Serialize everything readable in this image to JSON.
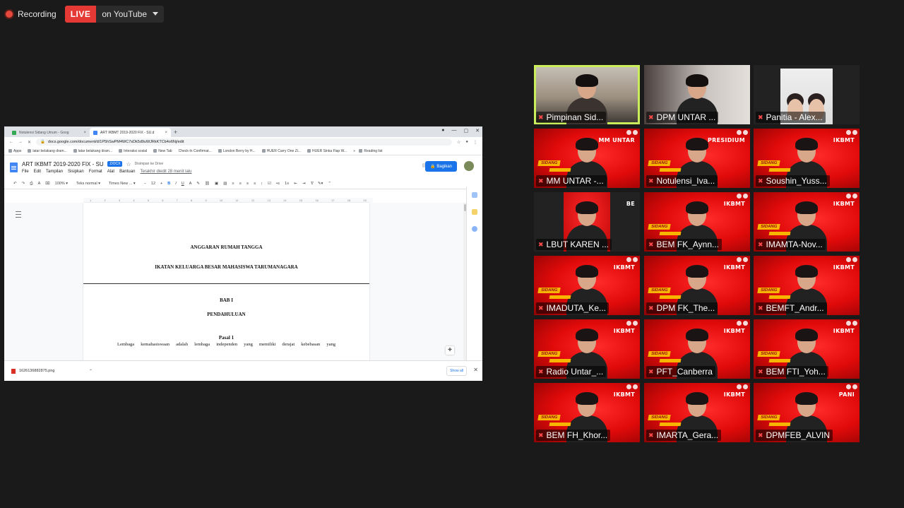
{
  "recording": {
    "label": "Recording"
  },
  "live": {
    "badge": "LIVE",
    "destination": "on YouTube"
  },
  "browser": {
    "tabs": [
      {
        "title": "Notulensi Sidang Umum - Goog",
        "icon": "docs-icon"
      },
      {
        "title": "ART IKBMT 2019-2020 FIX - SU.d",
        "icon": "docs-icon"
      }
    ],
    "url": "docs.google.com/document/d/1P5hSwPM4WC7sDk5d9uWJRkKTCb4o6Nj/edit",
    "bookmarks": [
      "Apps",
      "latar belakang dram...",
      "latar belakang dram...",
      "Interaksi sosial",
      "New Tab",
      "Check-In Confirmat...",
      "London Berry by H...",
      "HUER Carry One Zi...",
      "HUER Sinka Flap W...",
      "Reading list"
    ]
  },
  "doc": {
    "title": "ART IKBMT 2019-2020 FIX - SU",
    "format_badge": ".DOCX",
    "saved_status": "Disimpan ke Drive",
    "menu": [
      "File",
      "Edit",
      "Tampilan",
      "Sisipkan",
      "Format",
      "Alat",
      "Bantuan"
    ],
    "last_edit": "Terakhir diedit 28 menit lalu",
    "share_label": "Bagikan",
    "toolbar": {
      "zoom": "100%",
      "style": "Teks normal",
      "font": "Times New ...",
      "size": "12"
    },
    "ruler_ticks": [
      "1",
      "2",
      "3",
      "4",
      "5",
      "6",
      "7",
      "8",
      "9",
      "10",
      "11",
      "12",
      "13",
      "14",
      "15",
      "16",
      "17",
      "18",
      "19"
    ],
    "content": {
      "heading1": "ANGGARAN RUMAH TANGGA",
      "heading2": "IKATAN KELUARGA BESAR MAHASISWA TARUMANAGARA",
      "bab": "BAB I",
      "bab_title": "PENDAHULUAN",
      "pasal": "Pasal 1",
      "paragraph": "Lembaga kemahasiswaan adalah lembaga independen yang memiliki derajat kebebasan yang"
    },
    "download": {
      "file": "1626136882875.png",
      "show_all": "Show all"
    }
  },
  "participants": [
    {
      "name": "Pimpinan Sid...",
      "style": "room",
      "brand": "",
      "active": true
    },
    {
      "name": "DPM UNTAR ...",
      "style": "room2",
      "brand": ""
    },
    {
      "name": "Panitia - Alex...",
      "style": "photo",
      "brand": ""
    },
    {
      "name": "MM UNTAR -...",
      "style": "red",
      "brand": "MM UNTAR"
    },
    {
      "name": "Notulensi_Iva...",
      "style": "red",
      "brand": "PRESIDIUM"
    },
    {
      "name": "Soushin_Yuss...",
      "style": "red",
      "brand": "IKBMT"
    },
    {
      "name": "LBUT KAREN ...",
      "style": "lbut",
      "brand": "BE"
    },
    {
      "name": "BEM FK_Aynn...",
      "style": "red",
      "brand": "IKBMT"
    },
    {
      "name": "IMAMTA-Nov...",
      "style": "red",
      "brand": "IKBMT"
    },
    {
      "name": "IMADUTA_Ke...",
      "style": "red",
      "brand": "IKBMT"
    },
    {
      "name": "DPM FK_The...",
      "style": "red",
      "brand": "IKBMT"
    },
    {
      "name": "BEMFT_Andr...",
      "style": "red",
      "brand": "IKBMT"
    },
    {
      "name": "Radio Untar_...",
      "style": "red",
      "brand": "IKBMT"
    },
    {
      "name": "PFT_Canberra",
      "style": "red",
      "brand": "IKBMT"
    },
    {
      "name": "BEM FTI_Yoh...",
      "style": "red",
      "brand": "IKBMT"
    },
    {
      "name": "BEM FH_Khor...",
      "style": "red",
      "brand": "IKBMT"
    },
    {
      "name": "IMARTA_Gera...",
      "style": "red",
      "brand": "IKBMT"
    },
    {
      "name": "DPMFEB_ALVIN",
      "style": "red",
      "brand": "PANI"
    }
  ],
  "sidang_label": "SIDANG",
  "colors": {
    "live_red": "#e53935",
    "active_speaker": "#c9ed5b",
    "background": "#1a1a1a",
    "tile_red": "#e00a0a"
  }
}
